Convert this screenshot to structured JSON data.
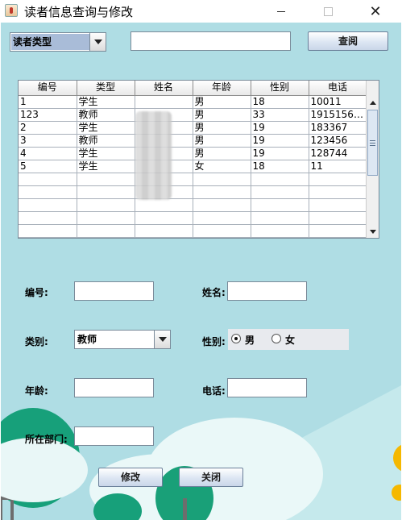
{
  "window": {
    "title": "读者信息查询与修改",
    "minimize_icon": "minimize-icon",
    "maximize_icon": "maximize-icon",
    "close_icon": "close-icon",
    "close_glyph": "✕"
  },
  "search": {
    "type_selected": "读者类型",
    "keyword_value": "",
    "query_label": "查阅"
  },
  "table": {
    "columns": [
      "编号",
      "类型",
      "姓名",
      "年龄",
      "性别",
      "电话"
    ],
    "rows": [
      [
        "1",
        "学生",
        "",
        "男",
        "18",
        "10011"
      ],
      [
        "123",
        "教师",
        "",
        "男",
        "33",
        "19151561..."
      ],
      [
        "2",
        "学生",
        "",
        "男",
        "19",
        "183367"
      ],
      [
        "3",
        "教师",
        "",
        "男",
        "19",
        "123456"
      ],
      [
        "4",
        "学生",
        "",
        "男",
        "19",
        "128744"
      ],
      [
        "5",
        "学生",
        "",
        "女",
        "18",
        "11"
      ]
    ],
    "empty_rows": 5
  },
  "form": {
    "id_label": "编号:",
    "id_value": "",
    "name_label": "姓名:",
    "name_value": "",
    "category_label": "类别:",
    "category_selected": "教师",
    "gender_label": "性别:",
    "gender_male": "男",
    "gender_female": "女",
    "gender_selected": "男",
    "age_label": "年龄:",
    "age_value": "",
    "phone_label": "电话:",
    "phone_value": "",
    "dept_label": "所在部门:",
    "dept_value": ""
  },
  "actions": {
    "modify_label": "修改",
    "close_label": "关闭"
  },
  "colors": {
    "background": "#afdde4",
    "button_top": "#ffffff",
    "button_bottom": "#c9d6e8",
    "tree_green": "#1aa37a",
    "cloud": "#e8f7f7",
    "sun": "#f5b800"
  }
}
